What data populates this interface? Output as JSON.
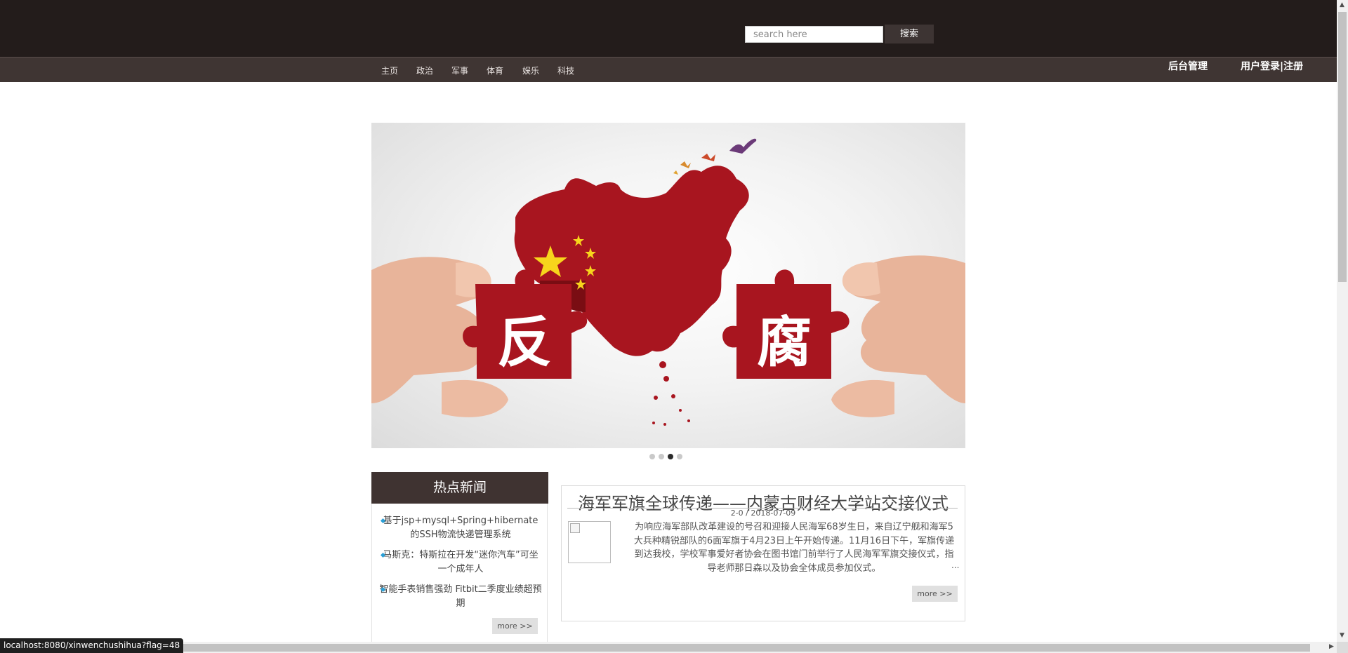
{
  "header": {
    "search_placeholder": "search here",
    "search_button": "搜索",
    "nav": [
      "主页",
      "政治",
      "军事",
      "体育",
      "娱乐",
      "科技"
    ],
    "admin_link": "后台管理",
    "login_link": "用户登录|注册"
  },
  "banner": {
    "puzzle_left": "反",
    "puzzle_right": "腐",
    "slide_count": 4,
    "active_slide": 3
  },
  "hot_news": {
    "title": "热点新闻",
    "items": [
      "基于jsp+mysql+Spring+hibernate的SSH物流快递管理系统",
      "马斯克：特斯拉在开发“迷你汽车”可坐一个成年人",
      "智能手表销售强劲 Fitbit二季度业绩超预期"
    ],
    "more": "more >>"
  },
  "article": {
    "title": "海军军旗全球传递——内蒙古财经大学站交接仪式",
    "meta": "2-0 /   2018-07-09",
    "body": "为响应海军部队改革建设的号召和迎接人民海军68岁生日，来自辽宁舰和海军5大兵种精锐部队的6面军旗于4月23日上午开始传递。11月16日下午，军旗传递到达我校，学校军事爱好者协会在图书馆门前举行了人民海军军旗交接仪式，指导老师那日森以及协会全体成员参加仪式。",
    "ellipsis": "...",
    "more": "more >>"
  },
  "status_bar": {
    "url": "localhost:8080/xinwenchushihua?flag=48"
  },
  "colors": {
    "header_bg": "#231c1b",
    "nav_bg": "#3f3533",
    "hot_head_bg": "#3f3331",
    "accent_bullet": "#2a9fd6",
    "puzzle_red": "#a8151f"
  }
}
